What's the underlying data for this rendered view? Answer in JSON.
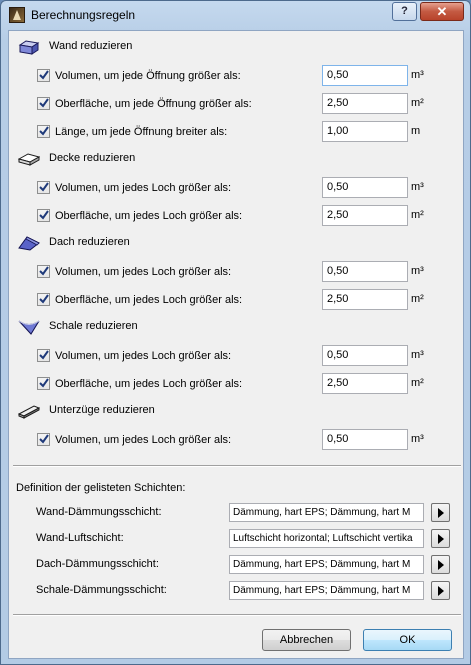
{
  "window": {
    "title": "Berechnungsregeln",
    "help_label": "?",
    "close_label": "✕"
  },
  "sections": [
    {
      "header": "Wand reduzieren",
      "icon": "wall-icon",
      "rows": [
        {
          "label": "Volumen, um jede Öffnung größer als:",
          "checked": true,
          "value": "0,50",
          "unit": "m³"
        },
        {
          "label": "Oberfläche, um jede Öffnung größer als:",
          "checked": true,
          "value": "2,50",
          "unit": "m²"
        },
        {
          "label": "Länge, um jede Öffnung breiter als:",
          "checked": true,
          "value": "1,00",
          "unit": "m"
        }
      ]
    },
    {
      "header": "Decke reduzieren",
      "icon": "slab-icon",
      "rows": [
        {
          "label": "Volumen, um jedes Loch größer als:",
          "checked": true,
          "value": "0,50",
          "unit": "m³"
        },
        {
          "label": "Oberfläche, um jedes Loch größer als:",
          "checked": true,
          "value": "2,50",
          "unit": "m²"
        }
      ]
    },
    {
      "header": "Dach reduzieren",
      "icon": "roof-icon",
      "rows": [
        {
          "label": "Volumen, um jedes Loch größer als:",
          "checked": true,
          "value": "0,50",
          "unit": "m³"
        },
        {
          "label": "Oberfläche, um jedes Loch größer als:",
          "checked": true,
          "value": "2,50",
          "unit": "m²"
        }
      ]
    },
    {
      "header": "Schale reduzieren",
      "icon": "shell-icon",
      "rows": [
        {
          "label": "Volumen, um jedes Loch größer als:",
          "checked": true,
          "value": "0,50",
          "unit": "m³"
        },
        {
          "label": "Oberfläche, um jedes Loch größer als:",
          "checked": true,
          "value": "2,50",
          "unit": "m²"
        }
      ]
    },
    {
      "header": "Unterzüge reduzieren",
      "icon": "beam-icon",
      "rows": [
        {
          "label": "Volumen, um jedes Loch größer als:",
          "checked": true,
          "value": "0,50",
          "unit": "m³"
        }
      ]
    }
  ],
  "definitions": {
    "title": "Definition der gelisteten Schichten:",
    "rows": [
      {
        "label": "Wand-Dämmungsschicht:",
        "value": "Dämmung, hart EPS; Dämmung, hart M"
      },
      {
        "label": "Wand-Luftschicht:",
        "value": "Luftschicht horizontal; Luftschicht vertika"
      },
      {
        "label": "Dach-Dämmungsschicht:",
        "value": "Dämmung, hart EPS; Dämmung, hart M"
      },
      {
        "label": "Schale-Dämmungsschicht:",
        "value": "Dämmung, hart EPS; Dämmung, hart M"
      }
    ]
  },
  "buttons": {
    "cancel": "Abbrechen",
    "ok": "OK"
  }
}
